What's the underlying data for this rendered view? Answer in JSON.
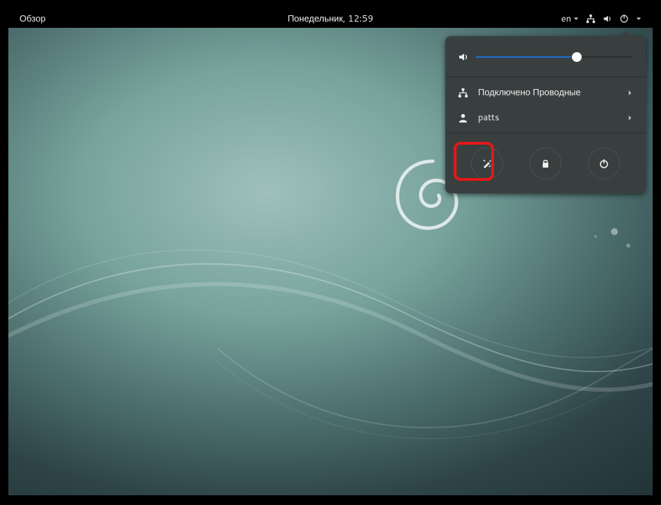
{
  "topbar": {
    "activities_label": "Обзор",
    "clock": "Понедельник, 12:59",
    "language": "en"
  },
  "system_menu": {
    "volume_percent": 64,
    "network_label": "Подключено Проводные",
    "user_label": "patts",
    "actions": {
      "settings_name": "settings",
      "lock_name": "lock",
      "power_name": "power"
    }
  },
  "colors": {
    "highlight": "#e61717",
    "accent": "#1f6fd0",
    "panel": "#393f3f"
  }
}
